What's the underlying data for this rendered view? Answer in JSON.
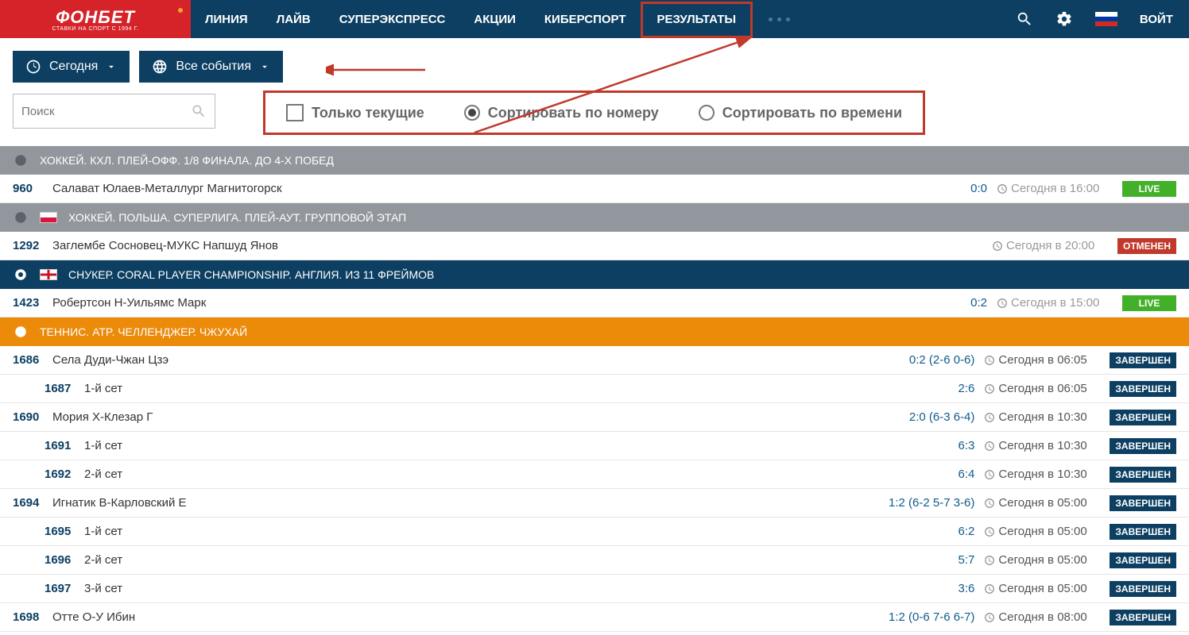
{
  "logo": {
    "main": "ФОНБЕТ",
    "sub": "СТАВКИ НА СПОРТ С 1994 Г."
  },
  "nav": {
    "line": "ЛИНИЯ",
    "live": "ЛАЙВ",
    "super": "СУПЕРЭКСПРЕСС",
    "promo": "АКЦИИ",
    "cyber": "КИБЕРСПОРТ",
    "results": "РЕЗУЛЬТАТЫ",
    "login": "ВОЙТ"
  },
  "toolbar": {
    "today": "Сегодня",
    "all": "Все события"
  },
  "search": {
    "placeholder": "Поиск"
  },
  "filters": {
    "current": "Только текущие",
    "bynum": "Сортировать по номеру",
    "bytime": "Сортировать по времени"
  },
  "cats": {
    "c1": "ХОККЕЙ. КХЛ. ПЛЕЙ-ОФФ. 1/8 ФИНАЛА. ДО 4-Х ПОБЕД",
    "c2": "ХОККЕЙ. ПОЛЬША. СУПЕРЛИГА. ПЛЕЙ-АУТ. ГРУППОВОЙ ЭТАП",
    "c3": "СНУКЕР. CORAL PLAYER CHAMPIONSHIP. АНГЛИЯ. ИЗ 11 ФРЕЙМОВ",
    "c4": "ТЕННИС. ATP. ЧЕЛЛЕНДЖЕР. ЧЖУХАЙ"
  },
  "badges": {
    "live": "LIVE",
    "done": "ЗАВЕРШЕН",
    "canc": "ОТМЕНЕН"
  },
  "ev": {
    "e960": {
      "n": "960",
      "name": "Салават Юлаев-Металлург Магнитогорск",
      "score": "0:0",
      "time": "Сегодня в 16:00"
    },
    "e1292": {
      "n": "1292",
      "name": "Заглембе Сосновец-МУКС Напшуд Янов",
      "score": "",
      "time": "Сегодня в 20:00"
    },
    "e1423": {
      "n": "1423",
      "name": "Робертсон Н-Уильямс Марк",
      "score": "0:2",
      "time": "Сегодня в 15:00"
    },
    "e1686": {
      "n": "1686",
      "name": "Села Дуди-Чжан Цзэ",
      "score": "0:2 (2-6 0-6)",
      "time": "Сегодня в 06:05"
    },
    "e1687": {
      "n": "1687",
      "name": "1-й сет",
      "score": "2:6",
      "time": "Сегодня в 06:05"
    },
    "e1690": {
      "n": "1690",
      "name": "Мория Х-Клезар Г",
      "score": "2:0 (6-3 6-4)",
      "time": "Сегодня в 10:30"
    },
    "e1691": {
      "n": "1691",
      "name": "1-й сет",
      "score": "6:3",
      "time": "Сегодня в 10:30"
    },
    "e1692": {
      "n": "1692",
      "name": "2-й сет",
      "score": "6:4",
      "time": "Сегодня в 10:30"
    },
    "e1694": {
      "n": "1694",
      "name": "Игнатик В-Карловский Е",
      "score": "1:2 (6-2 5-7 3-6)",
      "time": "Сегодня в 05:00"
    },
    "e1695": {
      "n": "1695",
      "name": "1-й сет",
      "score": "6:2",
      "time": "Сегодня в 05:00"
    },
    "e1696": {
      "n": "1696",
      "name": "2-й сет",
      "score": "5:7",
      "time": "Сегодня в 05:00"
    },
    "e1697": {
      "n": "1697",
      "name": "3-й сет",
      "score": "3:6",
      "time": "Сегодня в 05:00"
    },
    "e1698": {
      "n": "1698",
      "name": "Отте О-У Ибин",
      "score": "1:2 (0-6 7-6 6-7)",
      "time": "Сегодня в 08:00"
    }
  }
}
